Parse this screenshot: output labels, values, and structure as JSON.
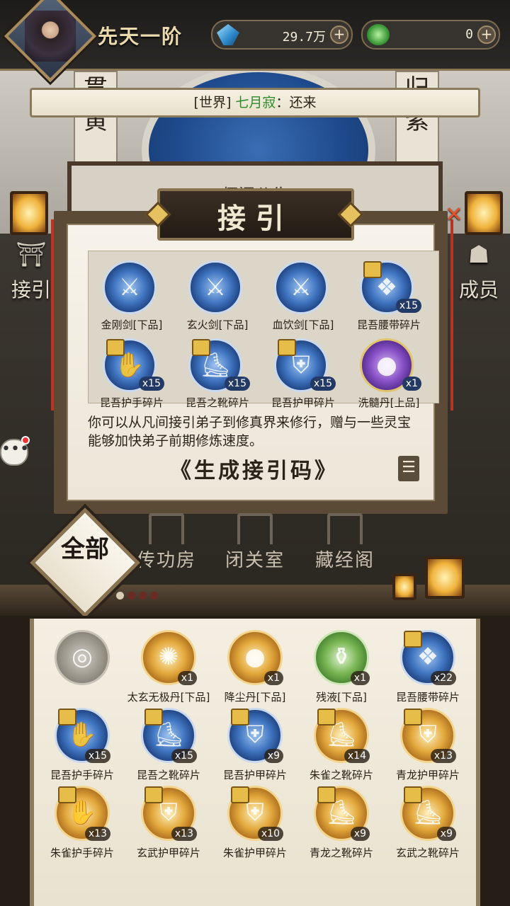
{
  "header": {
    "realm_label": "先天一阶",
    "resources": [
      {
        "name": "spirit-stone",
        "value": "29.7万",
        "icon": "blue-crystal-icon"
      },
      {
        "name": "jade",
        "value": "0",
        "icon": "green-jade-icon"
      }
    ]
  },
  "world_chat": {
    "channel": "[世界]",
    "sender": "七月寂",
    "separator": "：",
    "message": "还来"
  },
  "background": {
    "scroll_left": "贯黄",
    "scroll_right": "归紫",
    "notice_board_title": "师门公告"
  },
  "side_buttons": {
    "left_label": "接引",
    "right_label": "成员"
  },
  "dialog": {
    "title": "接引",
    "rewards": [
      {
        "name": "金刚剑[下品]",
        "count": "",
        "color": "blue",
        "glyph": "⚔"
      },
      {
        "name": "玄火剑[下品]",
        "count": "",
        "color": "blue",
        "glyph": "⚔"
      },
      {
        "name": "血饮剑[下品]",
        "count": "",
        "color": "blue",
        "glyph": "⚔"
      },
      {
        "name": "昆吾腰带碎片",
        "count": "x15",
        "color": "blue",
        "glyph": "❖"
      },
      {
        "name": "昆吾护手碎片",
        "count": "x15",
        "color": "blue",
        "glyph": "✋"
      },
      {
        "name": "昆吾之靴碎片",
        "count": "x15",
        "color": "blue",
        "glyph": "⛸"
      },
      {
        "name": "昆吾护甲碎片",
        "count": "x15",
        "color": "blue",
        "glyph": "⛨"
      },
      {
        "name": "洗髓丹[上品]",
        "count": "x1",
        "color": "purple",
        "glyph": "●"
      }
    ],
    "description": "你可以从凡间接引弟子到修真界来修行，赠与一些灵宝能够加快弟子前期修炼速度。",
    "generate_button": "《生成接引码》",
    "log_icon": "list-icon"
  },
  "nav": {
    "all_label": "全部",
    "tabs": [
      "传功房",
      "闭关室",
      "藏经阁"
    ]
  },
  "inventory": {
    "items": [
      {
        "name": "",
        "count": "",
        "color": "gray",
        "glyph": "◎"
      },
      {
        "name": "太玄无极丹[下品]",
        "count": "x1",
        "color": "gold",
        "glyph": "✺"
      },
      {
        "name": "降尘丹[下品]",
        "count": "x1",
        "color": "gold",
        "glyph": "●"
      },
      {
        "name": "残液[下品]",
        "count": "x1",
        "color": "green",
        "glyph": "⚱"
      },
      {
        "name": "昆吾腰带碎片",
        "count": "x22",
        "color": "blue",
        "glyph": "❖"
      },
      {
        "name": "昆吾护手碎片",
        "count": "x15",
        "color": "blue",
        "glyph": "✋"
      },
      {
        "name": "昆吾之靴碎片",
        "count": "x15",
        "color": "blue",
        "glyph": "⛸"
      },
      {
        "name": "昆吾护甲碎片",
        "count": "x9",
        "color": "blue",
        "glyph": "⛨"
      },
      {
        "name": "朱雀之靴碎片",
        "count": "x14",
        "color": "gold",
        "glyph": "⛸"
      },
      {
        "name": "青龙护甲碎片",
        "count": "x13",
        "color": "gold",
        "glyph": "⛨"
      },
      {
        "name": "朱雀护手碎片",
        "count": "x13",
        "color": "gold",
        "glyph": "✋"
      },
      {
        "name": "玄武护甲碎片",
        "count": "x13",
        "color": "gold",
        "glyph": "⛨"
      },
      {
        "name": "朱雀护甲碎片",
        "count": "x10",
        "color": "gold",
        "glyph": "⛨"
      },
      {
        "name": "青龙之靴碎片",
        "count": "x9",
        "color": "gold",
        "glyph": "⛸"
      },
      {
        "name": "玄武之靴碎片",
        "count": "x9",
        "color": "gold",
        "glyph": "⛸"
      }
    ]
  },
  "colors": {
    "chat_sender": "#2e8a2a",
    "accent_gold": "#e6c160",
    "close_red": "#e85028"
  }
}
